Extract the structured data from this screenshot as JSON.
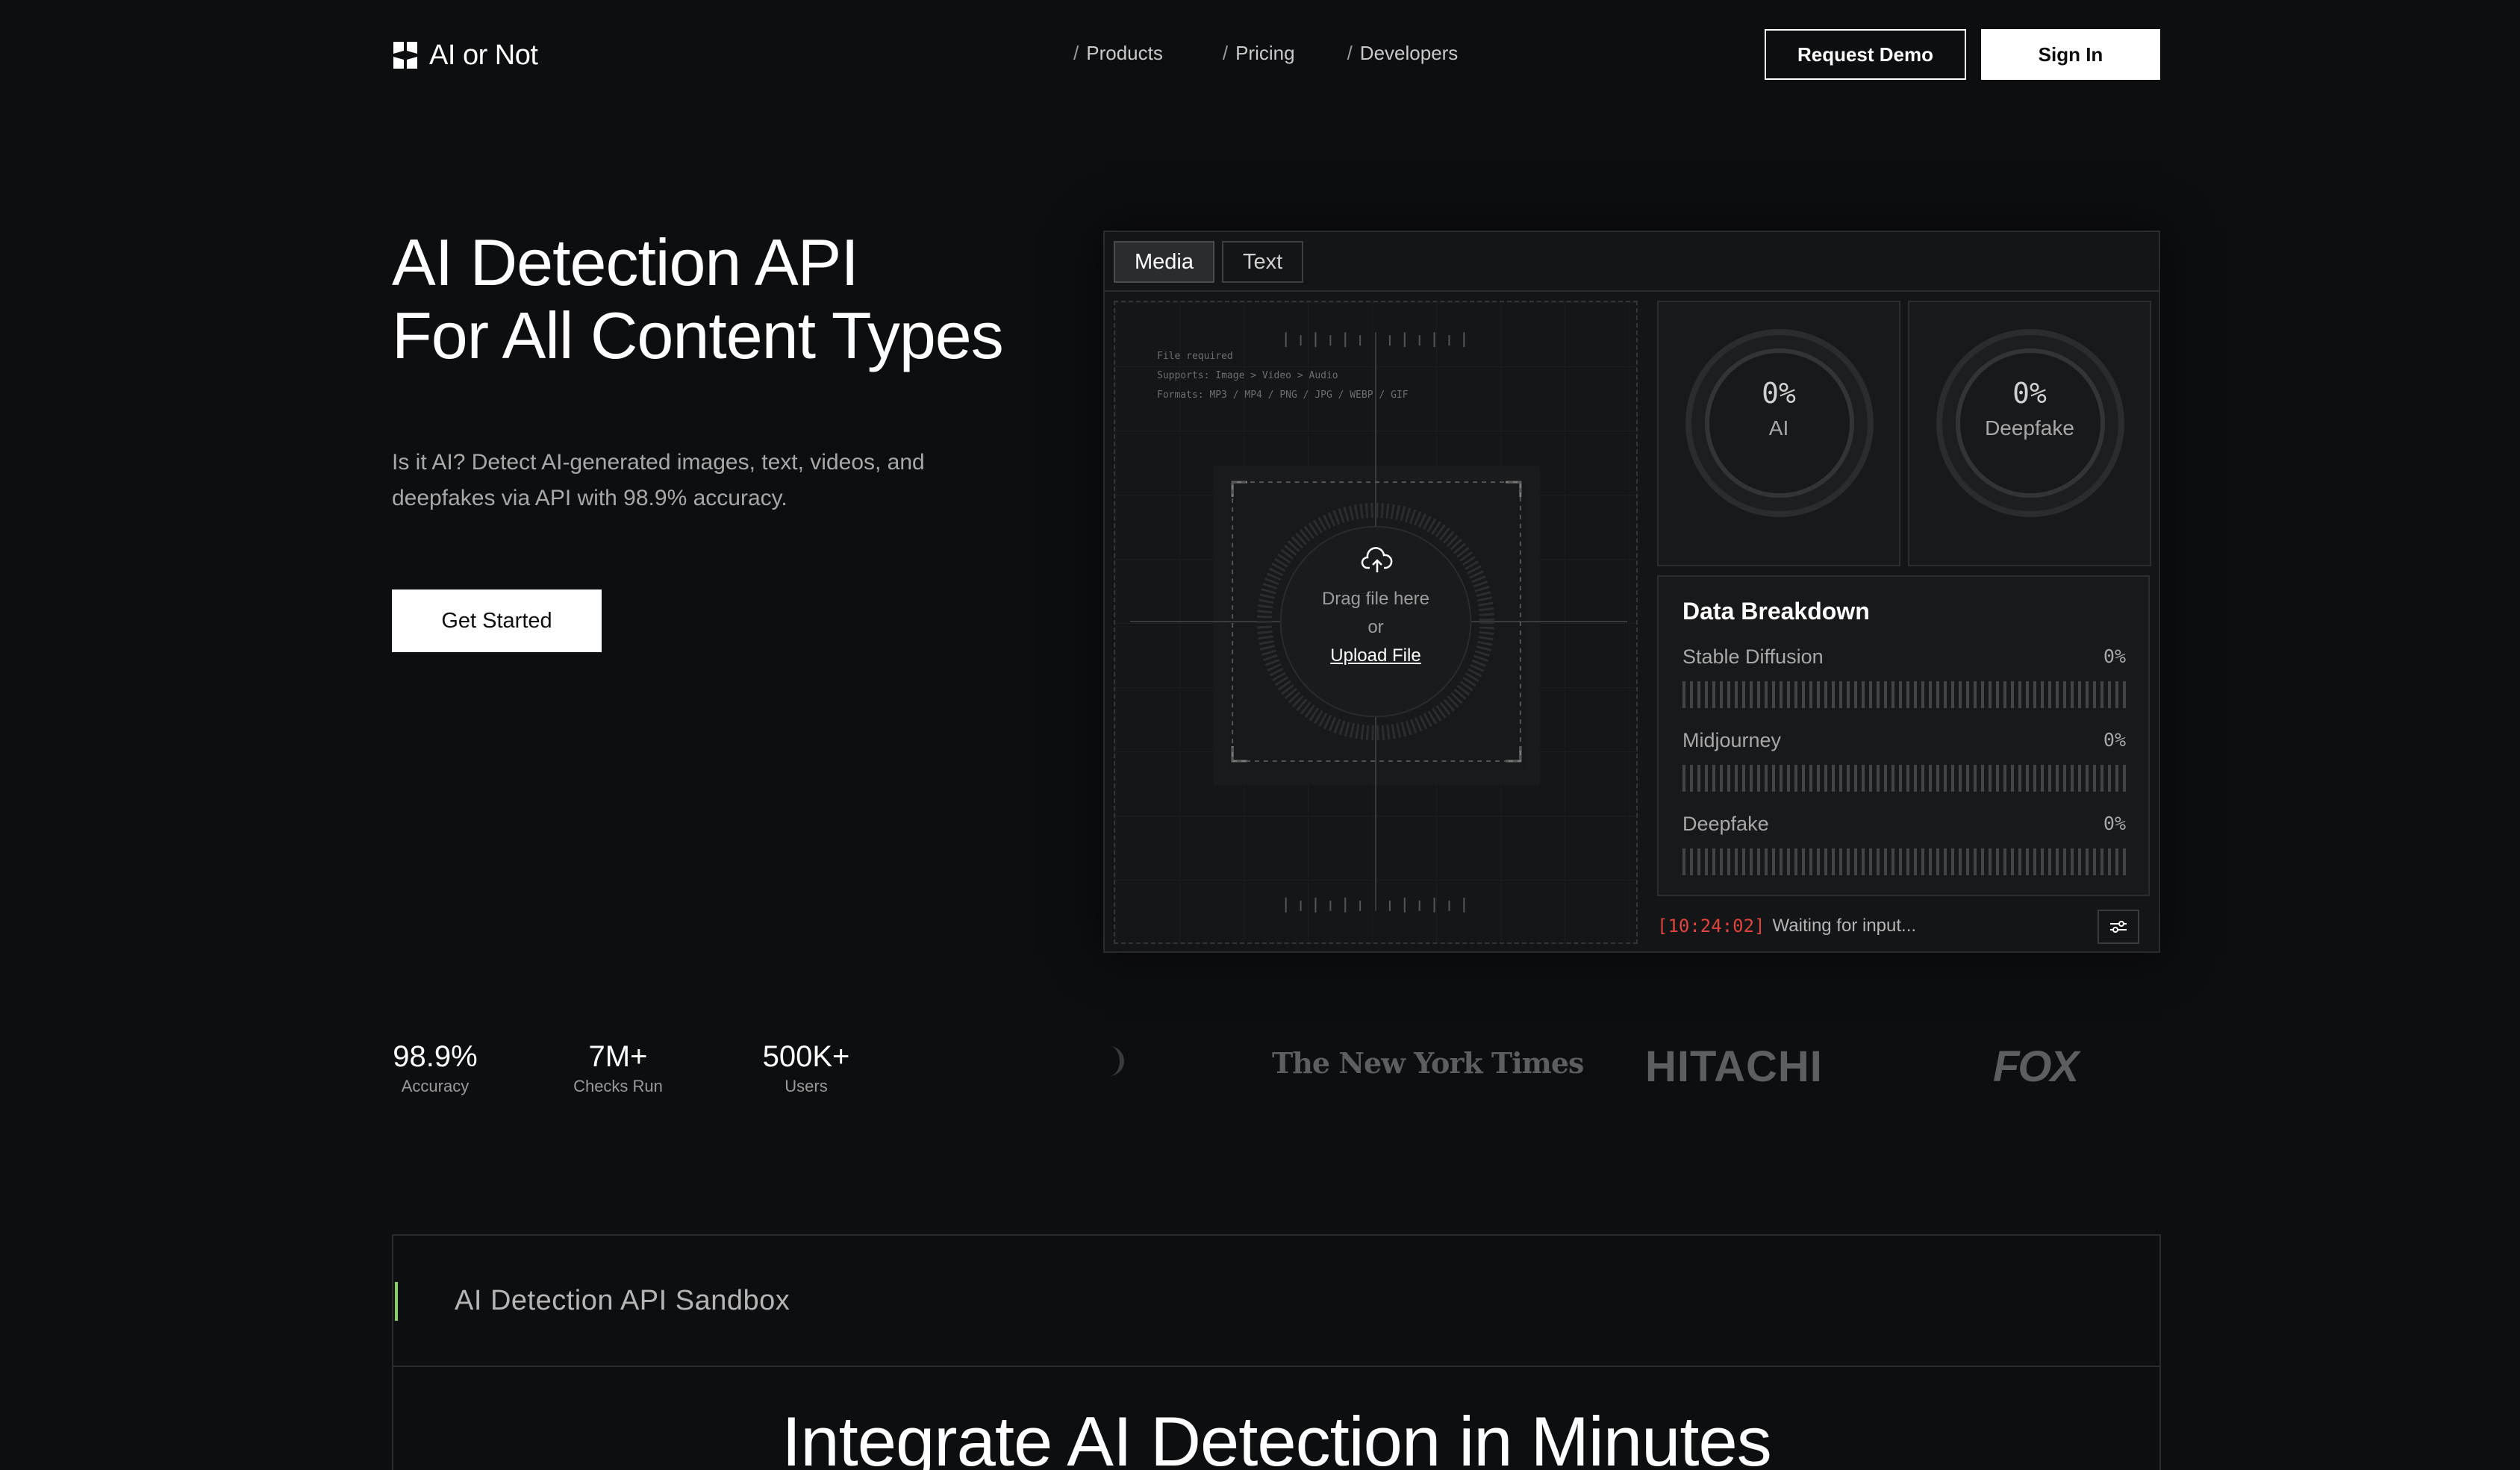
{
  "brand": {
    "name": "AI or Not"
  },
  "nav": {
    "links": [
      {
        "slash": "/",
        "label": "Products"
      },
      {
        "slash": "/",
        "label": "Pricing"
      },
      {
        "slash": "/",
        "label": "Developers"
      }
    ],
    "request_demo": "Request Demo",
    "sign_in": "Sign In"
  },
  "hero": {
    "title_line1": "AI Detection API",
    "title_line2": "For All Content Types",
    "description": "Is it AI? Detect AI-generated images, text, videos, and deepfakes via API with 98.9% accuracy.",
    "cta": "Get Started"
  },
  "widget": {
    "tabs": [
      "Media",
      "Text"
    ],
    "active_tab": "Media",
    "upload": {
      "meta_line1": "File required",
      "meta_line2": "Supports: Image > Video > Audio",
      "meta_line3": "Formats: MP3 / MP4 / PNG / JPG / WEBP / GIF",
      "drag_text": "Drag file here",
      "or_text": "or",
      "upload_link": "Upload File"
    },
    "scores": [
      {
        "value": "0%",
        "label": "AI"
      },
      {
        "value": "0%",
        "label": "Deepfake"
      }
    ],
    "breakdown": {
      "title": "Data Breakdown",
      "rows": [
        {
          "label": "Stable Diffusion",
          "value": "0%"
        },
        {
          "label": "Midjourney",
          "value": "0%"
        },
        {
          "label": "Deepfake",
          "value": "0%"
        }
      ]
    },
    "status": {
      "timestamp": "[10:24:02]",
      "text": "Waiting for input..."
    },
    "accent_red": "#e0443c"
  },
  "stats": [
    {
      "value": "98.9%",
      "label": "Accuracy"
    },
    {
      "value": "7M+",
      "label": "Checks Run"
    },
    {
      "value": "500K+",
      "label": "Users"
    }
  ],
  "logos": {
    "nyt": "The New York Times",
    "hitachi": "HITACHI",
    "fox": "FOX"
  },
  "sandbox": {
    "title": "AI Detection API Sandbox",
    "heading": "Integrate AI Detection in Minutes",
    "accent": "#8bd15f"
  }
}
